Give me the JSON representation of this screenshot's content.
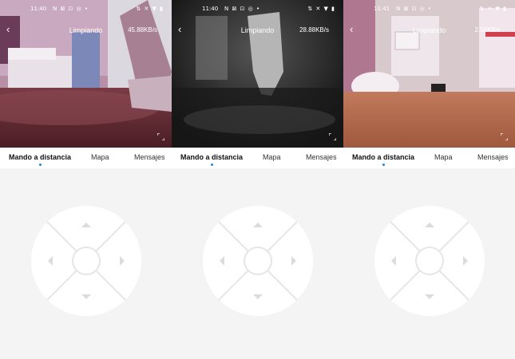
{
  "panels": [
    {
      "status": {
        "time": "11:40",
        "left_icons": "N ⊠ ⊡ ◎ •",
        "right_icons": "⇅ ✕ ▼ ▮"
      },
      "header": {
        "title": "Limpiando",
        "speed": "45.88KB/s"
      },
      "tabs": [
        {
          "label": "Mando a distancia",
          "active": true
        },
        {
          "label": "Mapa",
          "active": false
        },
        {
          "label": "Mensajes",
          "active": false
        }
      ]
    },
    {
      "status": {
        "time": "11:40",
        "left_icons": "N ⊠ ⊡ ◎ •",
        "right_icons": "⇅ ✕ ▼ ▮"
      },
      "header": {
        "title": "Limpiando",
        "speed": "28.88KB/s"
      },
      "tabs": [
        {
          "label": "Mando a distancia",
          "active": true
        },
        {
          "label": "Mapa",
          "active": false
        },
        {
          "label": "Mensajes",
          "active": false
        }
      ]
    },
    {
      "status": {
        "time": "11:41",
        "left_icons": "N ⊠ ⊡ ◎ •",
        "right_icons": "⇅ ✕ ▼ ▮"
      },
      "header": {
        "title": "Limpiando",
        "speed": "2.58KB/s"
      },
      "tabs": [
        {
          "label": "Mando a distancia",
          "active": true
        },
        {
          "label": "Mapa",
          "active": false
        },
        {
          "label": "Mensajes",
          "active": false
        }
      ]
    }
  ],
  "colors": {
    "accent": "#2a7fe0",
    "arrow": "#dcdcdc"
  },
  "icons": {
    "back": "chevron-left-icon",
    "fullscreen": "fullscreen-icon",
    "dpad": "direction-pad"
  }
}
